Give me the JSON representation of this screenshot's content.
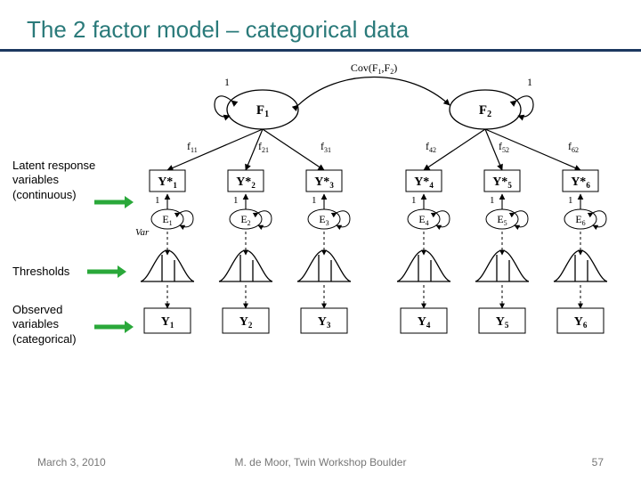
{
  "slide": {
    "title": "The 2 factor model – categorical data",
    "date": "March 3, 2010",
    "footer_center": "M. de Moor, Twin Workshop Boulder",
    "page": "57"
  },
  "diagram": {
    "cov_label": "Cov(F₁,F₂)",
    "var_one_left": "1",
    "var_one_right": "1",
    "var_label": "Var",
    "factors": [
      "F₁",
      "F₂"
    ],
    "loadings": [
      "f₁₁",
      "f₂₁",
      "f₃₁",
      "f₄₂",
      "f₅₂",
      "f₆₂"
    ],
    "latent_star": [
      "Y*₁",
      "Y*₂",
      "Y*₃",
      "Y*₄",
      "Y*₅",
      "Y*₆"
    ],
    "errors": [
      "E₁",
      "E₂",
      "E₃",
      "E₄",
      "E₅",
      "E₆"
    ],
    "error_one": "1",
    "observed": [
      "Y₁",
      "Y₂",
      "Y₃",
      "Y₄",
      "Y₅",
      "Y₆"
    ]
  },
  "annotations": {
    "latent_response": "Latent response variables (continuous)",
    "thresholds": "Thresholds",
    "observed": "Observed variables (categorical)"
  }
}
